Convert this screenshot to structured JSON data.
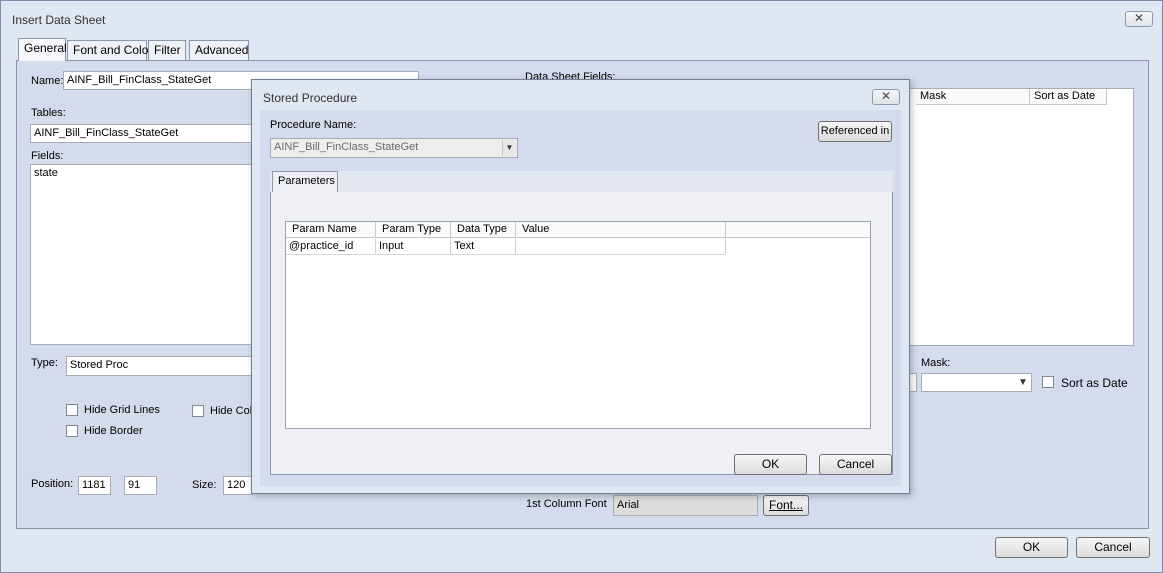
{
  "window": {
    "title": "Insert Data Sheet"
  },
  "tabs": [
    {
      "label": "General"
    },
    {
      "label": "Font and Color"
    },
    {
      "label": "Filter"
    },
    {
      "label": "Advanced"
    }
  ],
  "general": {
    "name_label": "Name:",
    "name_value": "AINF_Bill_FinClass_StateGet",
    "tables_label": "Tables:",
    "tables_value": "AINF_Bill_FinClass_StateGet",
    "fields_label": "Fields:",
    "fields_items": [
      "state"
    ],
    "type_label": "Type:",
    "type_value": "Stored Proc",
    "hide_grid_lines": "Hide Grid Lines",
    "hide_border": "Hide Border",
    "hide_col_partial": "Hide Col",
    "position_label": "Position:",
    "position_x": "1181",
    "position_y": "91",
    "size_label": "Size:",
    "size_value": "120",
    "data_sheet_fields_label": "Data Sheet Fields:",
    "dsf_columns": [
      "Mask",
      "Sort as Date"
    ],
    "mask_label": "Mask:",
    "sort_as_date": "Sort as Date",
    "first_col_font_label": "1st Column Font",
    "first_col_font_value": "Arial",
    "font_button": "Font..."
  },
  "footer": {
    "ok": "OK",
    "cancel": "Cancel"
  },
  "dialog": {
    "title": "Stored Procedure",
    "procedure_name_label": "Procedure Name:",
    "procedure_name_value": "AINF_Bill_FinClass_StateGet",
    "referenced_in": "Referenced in",
    "params_tab": "Parameters",
    "columns": [
      "Param Name",
      "Param Type",
      "Data Type",
      "Value"
    ],
    "rows": [
      {
        "name": "@practice_id",
        "type": "Input",
        "data_type": "Text",
        "value": ""
      }
    ],
    "ok": "OK",
    "cancel": "Cancel"
  }
}
